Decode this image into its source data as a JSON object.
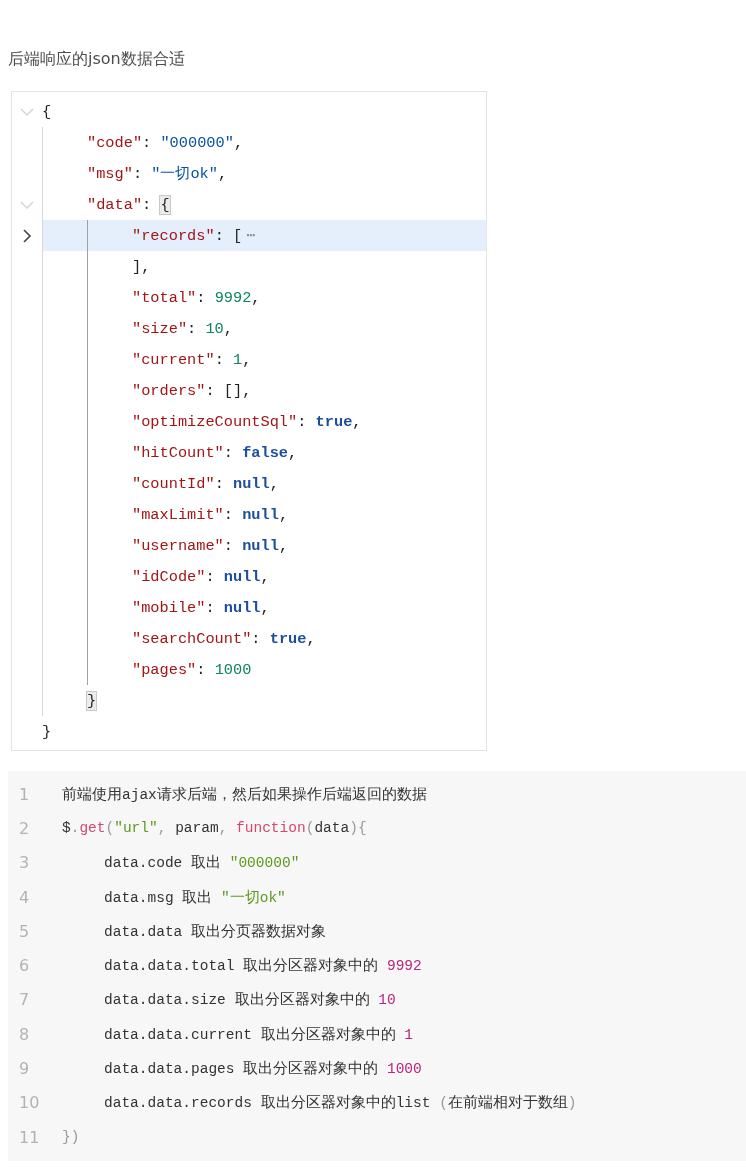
{
  "heading": "后端响应的json数据合适",
  "json_viewer": {
    "root": {
      "open": "{",
      "expanded": true,
      "selected": false,
      "close": "}",
      "children": [
        {
          "tokens": [
            {
              "kind": "key",
              "text": "\"code\""
            },
            {
              "kind": "punct",
              "text": ": "
            },
            {
              "kind": "string",
              "text": "\"000000\""
            },
            {
              "kind": "punct",
              "text": ","
            }
          ],
          "selected": false
        },
        {
          "tokens": [
            {
              "kind": "key",
              "text": "\"msg\""
            },
            {
              "kind": "punct",
              "text": ": "
            },
            {
              "kind": "string",
              "text": "\"一切ok\""
            },
            {
              "kind": "punct",
              "text": ","
            }
          ],
          "selected": false
        },
        {
          "tokens": [
            {
              "kind": "key",
              "text": "\"data\""
            },
            {
              "kind": "punct",
              "text": ": "
            }
          ],
          "open": "{",
          "expanded": true,
          "selected": false,
          "bracket_highlight": true,
          "close": "}",
          "children": [
            {
              "tokens": [
                {
                  "kind": "key",
                  "text": "\"records\""
                },
                {
                  "kind": "punct",
                  "text": ": "
                }
              ],
              "open": "[",
              "expanded": false,
              "selected": true,
              "ellipsis": "⋯",
              "close": "],"
            },
            {
              "tokens": [
                {
                  "kind": "key",
                  "text": "\"total\""
                },
                {
                  "kind": "punct",
                  "text": ": "
                },
                {
                  "kind": "number",
                  "text": "9992"
                },
                {
                  "kind": "punct",
                  "text": ","
                }
              ],
              "selected": false
            },
            {
              "tokens": [
                {
                  "kind": "key",
                  "text": "\"size\""
                },
                {
                  "kind": "punct",
                  "text": ": "
                },
                {
                  "kind": "number",
                  "text": "10"
                },
                {
                  "kind": "punct",
                  "text": ","
                }
              ],
              "selected": false
            },
            {
              "tokens": [
                {
                  "kind": "key",
                  "text": "\"current\""
                },
                {
                  "kind": "punct",
                  "text": ": "
                },
                {
                  "kind": "number",
                  "text": "1"
                },
                {
                  "kind": "punct",
                  "text": ","
                }
              ],
              "selected": false
            },
            {
              "tokens": [
                {
                  "kind": "key",
                  "text": "\"orders\""
                },
                {
                  "kind": "punct",
                  "text": ": [],"
                }
              ],
              "selected": false
            },
            {
              "tokens": [
                {
                  "kind": "key",
                  "text": "\"optimizeCountSql\""
                },
                {
                  "kind": "punct",
                  "text": ": "
                },
                {
                  "kind": "literal",
                  "text": "true"
                },
                {
                  "kind": "punct",
                  "text": ","
                }
              ],
              "selected": false
            },
            {
              "tokens": [
                {
                  "kind": "key",
                  "text": "\"hitCount\""
                },
                {
                  "kind": "punct",
                  "text": ": "
                },
                {
                  "kind": "literal",
                  "text": "false"
                },
                {
                  "kind": "punct",
                  "text": ","
                }
              ],
              "selected": false
            },
            {
              "tokens": [
                {
                  "kind": "key",
                  "text": "\"countId\""
                },
                {
                  "kind": "punct",
                  "text": ": "
                },
                {
                  "kind": "literal",
                  "text": "null"
                },
                {
                  "kind": "punct",
                  "text": ","
                }
              ],
              "selected": false
            },
            {
              "tokens": [
                {
                  "kind": "key",
                  "text": "\"maxLimit\""
                },
                {
                  "kind": "punct",
                  "text": ": "
                },
                {
                  "kind": "literal",
                  "text": "null"
                },
                {
                  "kind": "punct",
                  "text": ","
                }
              ],
              "selected": false
            },
            {
              "tokens": [
                {
                  "kind": "key",
                  "text": "\"username\""
                },
                {
                  "kind": "punct",
                  "text": ": "
                },
                {
                  "kind": "literal",
                  "text": "null"
                },
                {
                  "kind": "punct",
                  "text": ","
                }
              ],
              "selected": false
            },
            {
              "tokens": [
                {
                  "kind": "key",
                  "text": "\"idCode\""
                },
                {
                  "kind": "punct",
                  "text": ": "
                },
                {
                  "kind": "literal",
                  "text": "null"
                },
                {
                  "kind": "punct",
                  "text": ","
                }
              ],
              "selected": false
            },
            {
              "tokens": [
                {
                  "kind": "key",
                  "text": "\"mobile\""
                },
                {
                  "kind": "punct",
                  "text": ": "
                },
                {
                  "kind": "literal",
                  "text": "null"
                },
                {
                  "kind": "punct",
                  "text": ","
                }
              ],
              "selected": false
            },
            {
              "tokens": [
                {
                  "kind": "key",
                  "text": "\"searchCount\""
                },
                {
                  "kind": "punct",
                  "text": ": "
                },
                {
                  "kind": "literal",
                  "text": "true"
                },
                {
                  "kind": "punct",
                  "text": ","
                }
              ],
              "selected": false
            },
            {
              "tokens": [
                {
                  "kind": "key",
                  "text": "\"pages\""
                },
                {
                  "kind": "punct",
                  "text": ": "
                },
                {
                  "kind": "number",
                  "text": "1000"
                }
              ],
              "selected": false
            }
          ]
        }
      ]
    }
  },
  "code_block": {
    "lines": [
      {
        "number": "1",
        "tokens": [
          {
            "kind": "plain",
            "text": "前端使用ajax请求后端，然后如果操作后端返回的数据"
          }
        ]
      },
      {
        "number": "2",
        "tokens": [
          {
            "kind": "plain",
            "text": "$"
          },
          {
            "kind": "punct",
            "text": "."
          },
          {
            "kind": "keyword",
            "text": "get"
          },
          {
            "kind": "punct",
            "text": "("
          },
          {
            "kind": "string",
            "text": "\"url\""
          },
          {
            "kind": "punct",
            "text": ", "
          },
          {
            "kind": "plain",
            "text": "param"
          },
          {
            "kind": "punct",
            "text": ", "
          },
          {
            "kind": "keyword",
            "text": "function"
          },
          {
            "kind": "punct",
            "text": "("
          },
          {
            "kind": "plain",
            "text": "data"
          },
          {
            "kind": "punct",
            "text": "){"
          }
        ],
        "children": [
          {
            "number": "3",
            "tokens": [
              {
                "kind": "plain",
                "text": "data.code 取出 "
              },
              {
                "kind": "string",
                "text": "\"000000\""
              }
            ]
          },
          {
            "number": "4",
            "tokens": [
              {
                "kind": "plain",
                "text": "data.msg 取出 "
              },
              {
                "kind": "string",
                "text": "\"一切ok\""
              }
            ]
          },
          {
            "number": "5",
            "tokens": [
              {
                "kind": "plain",
                "text": "data.data 取出分页器数据对象"
              }
            ]
          },
          {
            "number": "6",
            "tokens": [
              {
                "kind": "plain",
                "text": "data.data.total 取出分区器对象中的 "
              },
              {
                "kind": "number",
                "text": "9992"
              }
            ]
          },
          {
            "number": "7",
            "tokens": [
              {
                "kind": "plain",
                "text": "data.data.size 取出分区器对象中的 "
              },
              {
                "kind": "number",
                "text": "10"
              }
            ]
          },
          {
            "number": "8",
            "tokens": [
              {
                "kind": "plain",
                "text": "data.data.current 取出分区器对象中的 "
              },
              {
                "kind": "number",
                "text": "1"
              }
            ]
          },
          {
            "number": "9",
            "tokens": [
              {
                "kind": "plain",
                "text": "data.data.pages 取出分区器对象中的 "
              },
              {
                "kind": "number",
                "text": "1000"
              }
            ]
          },
          {
            "number": "10",
            "tokens": [
              {
                "kind": "plain",
                "text": "data.data.records 取出分区器对象中的list "
              },
              {
                "kind": "punct",
                "text": "("
              },
              {
                "kind": "plain",
                "text": "在前端相对于数组"
              },
              {
                "kind": "punct",
                "text": ")"
              }
            ]
          }
        ]
      },
      {
        "number": "11",
        "tokens": [
          {
            "kind": "punct",
            "text": "})"
          }
        ]
      }
    ]
  }
}
